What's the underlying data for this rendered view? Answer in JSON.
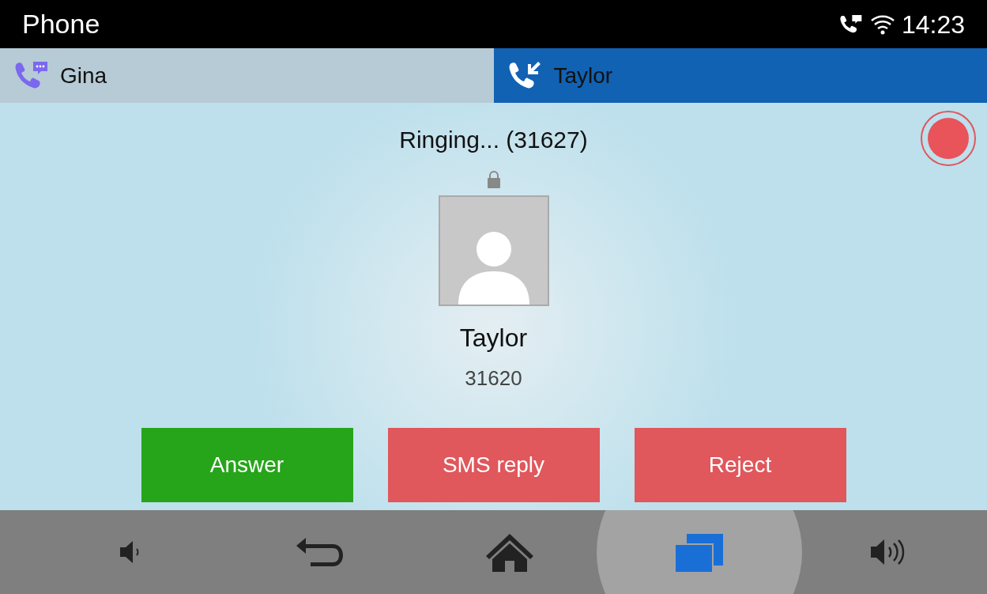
{
  "status_bar": {
    "title": "Phone",
    "time": "14:23"
  },
  "tabs": [
    {
      "label": "Gina",
      "kind": "message",
      "selected": false
    },
    {
      "label": "Taylor",
      "kind": "incoming",
      "selected": true
    }
  ],
  "call": {
    "status": "Ringing... (31627)",
    "name": "Taylor",
    "number": "31620",
    "recording": false
  },
  "actions": [
    {
      "label": "Answer",
      "kind": "accept"
    },
    {
      "label": "SMS reply",
      "kind": "decline"
    },
    {
      "label": "Reject",
      "kind": "decline"
    }
  ],
  "nav": [
    {
      "kind": "volume-down",
      "selected": false
    },
    {
      "kind": "back",
      "selected": false
    },
    {
      "kind": "home",
      "selected": false
    },
    {
      "kind": "recents",
      "selected": true
    },
    {
      "kind": "volume-up",
      "selected": false
    }
  ]
}
